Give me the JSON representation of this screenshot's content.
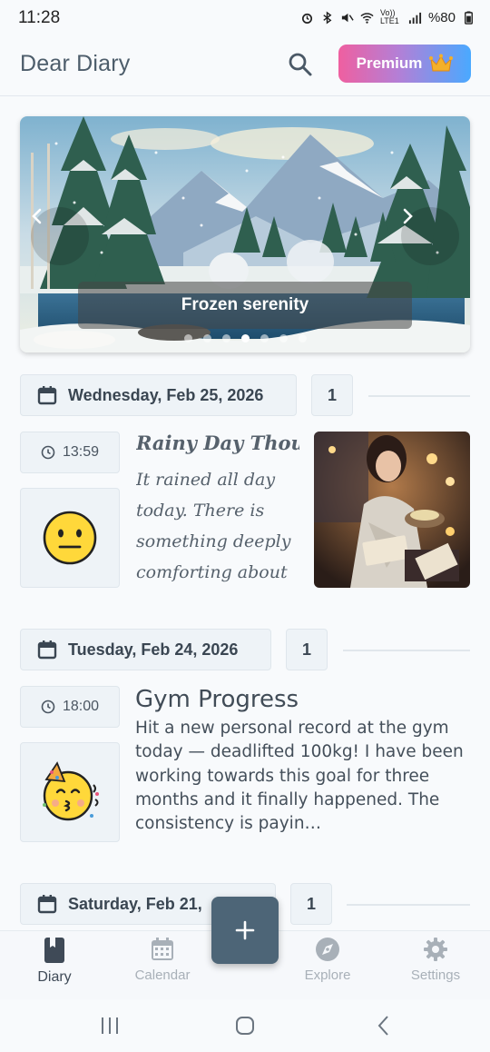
{
  "status_bar": {
    "time": "11:28",
    "battery": "%80",
    "network": "Vo)) LTE1"
  },
  "app_bar": {
    "title": "Dear Diary",
    "premium_label": "Premium"
  },
  "hero": {
    "caption": "Frozen serenity",
    "dots": 7,
    "active_dot_index": 3
  },
  "days": [
    {
      "date": "Wednesday, Feb 25, 2026",
      "count": "1",
      "entry": {
        "time": "13:59",
        "mood": "neutral-face",
        "title": "Rainy Day Thoug…",
        "body": "It rained all day today. There is something deeply comforting about …",
        "has_photo": true
      }
    },
    {
      "date": "Tuesday, Feb 24, 2026",
      "count": "1",
      "entry": {
        "time": "18:00",
        "mood": "party-kiss-face",
        "title": "Gym Progress",
        "body": "Hit a new personal record at the gym today — deadlifted 100kg! I have been working towards this goal for three months and it finally happened. The consistency is payin…"
      }
    },
    {
      "date": "Saturday, Feb 21,",
      "count": "1"
    }
  ],
  "bottom_nav": [
    {
      "label": "Diary",
      "icon": "book-icon",
      "active": true
    },
    {
      "label": "Calendar",
      "icon": "calendar-icon",
      "active": false
    },
    {
      "label": "Explore",
      "icon": "compass-icon",
      "active": false
    },
    {
      "label": "Settings",
      "icon": "gear-icon",
      "active": false
    }
  ],
  "colors": {
    "accent": "#4d6577",
    "premium_start": "#ef5fa0",
    "premium_end": "#4aa9ff"
  }
}
